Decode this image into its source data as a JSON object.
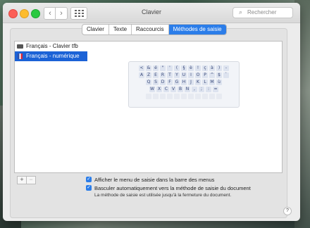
{
  "window": {
    "title": "Clavier"
  },
  "toolbar": {
    "back_glyph": "‹",
    "forward_glyph": "›",
    "search_placeholder": "Rechercher"
  },
  "tabs": [
    {
      "label": "Clavier",
      "active": false
    },
    {
      "label": "Texte",
      "active": false
    },
    {
      "label": "Raccourcis",
      "active": false
    },
    {
      "label": "Méthodes de saisie",
      "active": true
    }
  ],
  "input_sources": [
    {
      "label": "Français - Clavier tfb",
      "icon": "keyboard-icon",
      "selected": false
    },
    {
      "label": "Français - numérique",
      "icon": "french-flag-icon",
      "selected": true
    }
  ],
  "keyboard_rows": [
    [
      "<",
      "&",
      "é",
      "\"",
      "'",
      "(",
      "§",
      "è",
      "!",
      "ç",
      "à",
      ")",
      "-"
    ],
    [
      "A",
      "Z",
      "E",
      "R",
      "T",
      "Y",
      "U",
      "I",
      "O",
      "P",
      "^",
      "$",
      "`"
    ],
    [
      "Q",
      "S",
      "D",
      "F",
      "G",
      "H",
      "J",
      "K",
      "L",
      "M",
      "ù"
    ],
    [
      "W",
      "X",
      "C",
      "V",
      "B",
      "N",
      ",",
      ";",
      ":",
      "="
    ]
  ],
  "buttons": {
    "add": "+",
    "remove": "−"
  },
  "options": {
    "show_menu_label": "Afficher le menu de saisie dans la barre des menus",
    "show_menu_checked": true,
    "auto_switch_label": "Basculer automatiquement vers la méthode de saisie du document",
    "auto_switch_checked": true,
    "note": "La méthode de saisie est utilisée jusqu'à la fermeture du document."
  },
  "help_glyph": "?",
  "colors": {
    "accent": "#2b7de9",
    "selection": "#1b62d6"
  }
}
